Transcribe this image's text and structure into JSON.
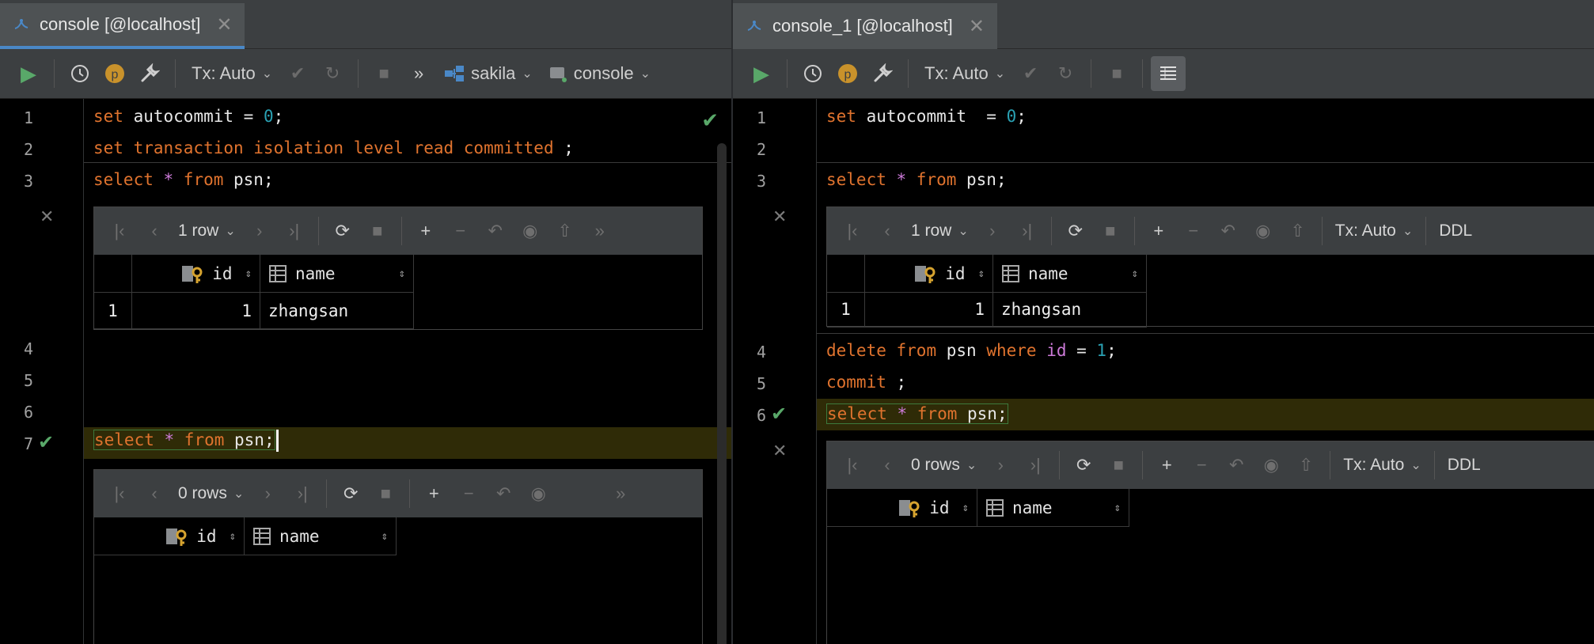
{
  "left": {
    "tab": {
      "title": "console [@localhost]",
      "close": "✕"
    },
    "toolbar": {
      "tx_label": "Tx: Auto",
      "more": "»",
      "schema": "sakila",
      "session": "console"
    },
    "lines": [
      {
        "n": "1"
      },
      {
        "n": "2"
      },
      {
        "n": "3"
      },
      {
        "n": "4"
      },
      {
        "n": "5"
      },
      {
        "n": "6"
      },
      {
        "n": "7"
      }
    ],
    "code": {
      "l1_kw": "set",
      "l1_rest": " autocommit = ",
      "l1_num": "0",
      "l1_end": ";",
      "l2_kw": "set transaction isolation level read committed",
      "l2_end": " ;",
      "l3_kw1": "select",
      "l3_op": " * ",
      "l3_kw2": "from",
      "l3_rest": " psn;",
      "l7_kw1": "select",
      "l7_op": " * ",
      "l7_kw2": "from",
      "l7_rest": " psn;"
    },
    "result1": {
      "rows_label": "1 row",
      "more": "»",
      "cols": [
        "id",
        "name"
      ],
      "rows": [
        {
          "row_num": "1",
          "id": "1",
          "name": "zhangsan"
        }
      ]
    },
    "result2": {
      "rows_label": "0 rows",
      "more": "»",
      "cols": [
        "id",
        "name"
      ]
    },
    "gutter_close": "✕"
  },
  "right": {
    "tab": {
      "title": "console_1 [@localhost]",
      "close": "✕"
    },
    "toolbar": {
      "tx_label": "Tx: Auto"
    },
    "lines": [
      {
        "n": "1"
      },
      {
        "n": "2"
      },
      {
        "n": "3"
      },
      {
        "n": "4"
      },
      {
        "n": "5"
      },
      {
        "n": "6"
      }
    ],
    "code": {
      "l1_kw": "set",
      "l1_rest": " autocommit  = ",
      "l1_num": "0",
      "l1_end": ";",
      "l3_kw1": "select",
      "l3_op": " * ",
      "l3_kw2": "from",
      "l3_rest": " psn;",
      "l4_kw1": "delete",
      "l4_sp1": " ",
      "l4_kw2": "from",
      "l4_mid": " psn ",
      "l4_kw3": "where",
      "l4_sp2": " ",
      "l4_col": "id",
      "l4_eq": " = ",
      "l4_num": "1",
      "l4_end": ";",
      "l5_kw": "commit",
      "l5_end": " ;",
      "l6_kw1": "select",
      "l6_op": " * ",
      "l6_kw2": "from",
      "l6_rest": " psn;"
    },
    "result1": {
      "rows_label": "1 row",
      "tx_label": "Tx: Auto",
      "ddl": "DDL",
      "cols": [
        "id",
        "name"
      ],
      "rows": [
        {
          "row_num": "1",
          "id": "1",
          "name": "zhangsan"
        }
      ]
    },
    "result2": {
      "rows_label": "0 rows",
      "tx_label": "Tx: Auto",
      "ddl": "DDL",
      "cols": [
        "id",
        "name"
      ]
    },
    "gutter_close": "✕"
  },
  "colors": {
    "keyword": "#e0732e",
    "number": "#2aa1b3",
    "operator": "#cc7ad8",
    "success": "#59a869",
    "tab_accent": "#4a88c7",
    "current_line": "#2f2b07"
  },
  "icons": [
    "database-icon",
    "play-icon",
    "history-icon",
    "p-badge-icon",
    "wrench-icon",
    "check-icon",
    "undo-icon",
    "stop-icon",
    "schema-icon",
    "session-icon",
    "grid-view-icon",
    "first-page-icon",
    "prev-page-icon",
    "next-page-icon",
    "last-page-icon",
    "refresh-icon",
    "add-row-icon",
    "remove-row-icon",
    "revert-icon",
    "preview-icon",
    "submit-icon",
    "key-column-icon",
    "column-icon",
    "sort-icon"
  ]
}
